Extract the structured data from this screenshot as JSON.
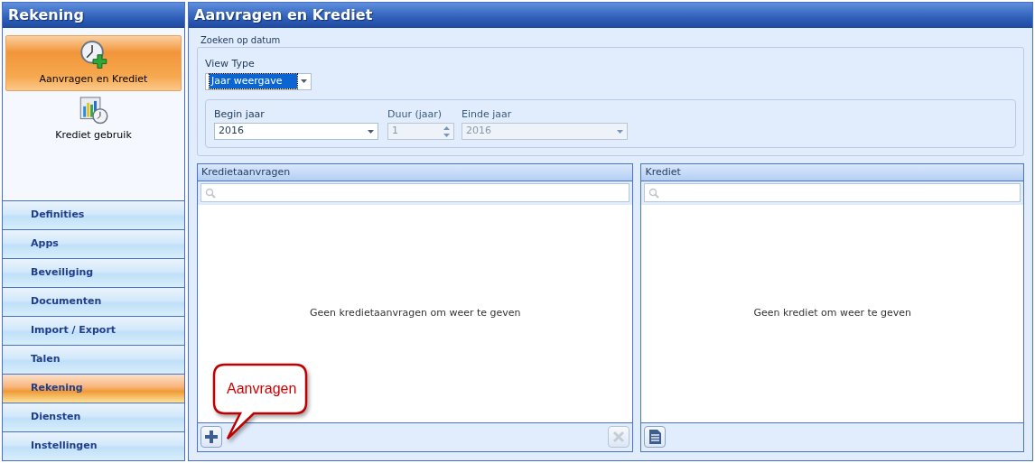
{
  "sidebar": {
    "title": "Rekening",
    "tiles": [
      {
        "label": "Aanvragen en Krediet",
        "selected": true,
        "kind": "clock-plus"
      },
      {
        "label": "Krediet gebruik",
        "selected": false,
        "kind": "chart-clock"
      }
    ],
    "nav": [
      {
        "label": "Definities",
        "selected": false
      },
      {
        "label": "Apps",
        "selected": false
      },
      {
        "label": "Beveiliging",
        "selected": false
      },
      {
        "label": "Documenten",
        "selected": false
      },
      {
        "label": "Import / Export",
        "selected": false
      },
      {
        "label": "Talen",
        "selected": false
      },
      {
        "label": "Rekening",
        "selected": true
      },
      {
        "label": "Diensten",
        "selected": false
      },
      {
        "label": "Instellingen",
        "selected": false
      }
    ]
  },
  "main": {
    "title": "Aanvragen en Krediet",
    "filter": {
      "title": "Zoeken op datum",
      "view_type": {
        "label": "View Type",
        "value": "Jaar weergave"
      },
      "fields": [
        {
          "label": "Begin jaar",
          "value": "2016",
          "kind": "dropdown",
          "disabled": false
        },
        {
          "label": "Duur (jaar)",
          "value": "1",
          "kind": "spinner",
          "disabled": true
        },
        {
          "label": "Einde jaar",
          "value": "2016",
          "kind": "dropdown",
          "disabled": true
        }
      ]
    },
    "panels": [
      {
        "title": "Kredietaanvragen",
        "empty_text": "Geen kredietaanvragen om weer te geven",
        "actions": [
          {
            "kind": "add",
            "disabled": false
          },
          {
            "kind": "delete",
            "disabled": true
          }
        ]
      },
      {
        "title": "Krediet",
        "empty_text": "Geen krediet om weer te geven",
        "actions": [
          {
            "kind": "report",
            "disabled": false
          }
        ]
      }
    ],
    "callout": {
      "text": "Aanvragen"
    }
  }
}
